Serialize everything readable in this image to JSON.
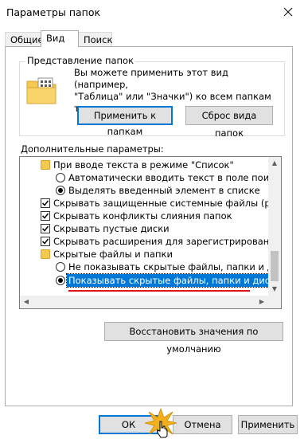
{
  "window": {
    "title": "Параметры папок"
  },
  "tabs": [
    {
      "label": "Общие"
    },
    {
      "label": "Вид"
    },
    {
      "label": "Поиск"
    }
  ],
  "folder_view": {
    "legend": "Представление папок",
    "description_lines": [
      "Вы можете применить этот вид (например,",
      "\"Таблица\" или \"Значки\") ко всем папкам",
      "такого типа."
    ],
    "apply_button": "Применить к папкам",
    "reset_button": "Сброс вида папок"
  },
  "advanced": {
    "label": "Дополнительные параметры:",
    "items": [
      {
        "type": "folder",
        "text": "При вводе текста в режиме \"Список\""
      },
      {
        "type": "radio",
        "checked": false,
        "text": "Автоматически вводить текст в поле поиска"
      },
      {
        "type": "radio",
        "checked": true,
        "text": "Выделять введенный элемент в списке"
      },
      {
        "type": "checkbox",
        "checked": true,
        "text": "Скрывать защищенные системные файлы (рекомен"
      },
      {
        "type": "checkbox",
        "checked": true,
        "text": "Скрывать конфликты слияния папок"
      },
      {
        "type": "checkbox",
        "checked": true,
        "text": "Скрывать пустые диски"
      },
      {
        "type": "checkbox",
        "checked": true,
        "text": "Скрывать расширения для зарегистрированных типо"
      },
      {
        "type": "folder",
        "text": "Скрытые файлы и папки"
      },
      {
        "type": "radio",
        "checked": false,
        "text": "Не показывать скрытые файлы, папки и диски"
      },
      {
        "type": "radio",
        "checked": true,
        "selected": true,
        "text": "Показывать скрытые файлы, папки и диски"
      }
    ],
    "restore_button": "Восстановить значения по умолчанию"
  },
  "footer": {
    "ok": "ОК",
    "cancel": "Отмена",
    "apply": "Применить"
  },
  "colors": {
    "selection": "#0078d7",
    "annotation_line": "#e01010",
    "focus_border": "#0078d7"
  }
}
